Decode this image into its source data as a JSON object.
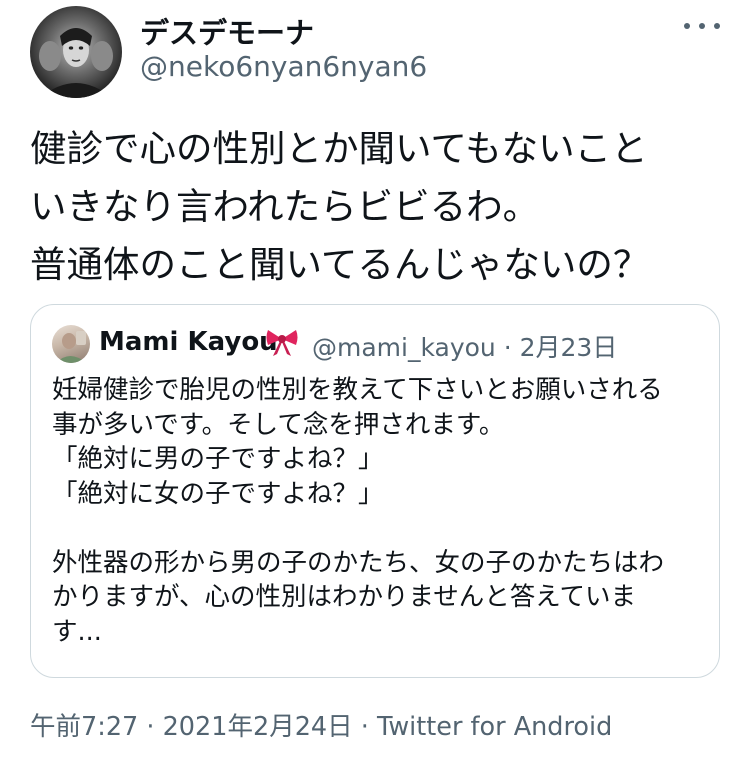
{
  "author": {
    "display_name": "デスデモーナ",
    "handle": "@neko6nyan6nyan6"
  },
  "tweet": {
    "lines": [
      "健診で心の性別とか聞いてもないこと",
      "いきなり言われたらビビるわ。",
      "普通体のこと聞いてるんじゃないの？"
    ]
  },
  "quoted_tweet": {
    "author_name": "Mami Kayou",
    "author_emoji_icon": "ribbon-icon",
    "handle_and_date": "@mami_kayou · 2月23日",
    "lines": [
      "妊婦健診で胎児の性別を教えて下さいとお願いされる",
      "事が多いです。そして念を押されます。",
      "「絶対に男の子ですよね？」",
      "「絶対に女の子ですよね？」",
      "",
      "外性器の形から男の子のかたち、女の子のかたちはわ",
      "かりますが、心の性別はわかりませんと答えていま",
      "す..."
    ]
  },
  "meta": {
    "timestamp_and_source": "午前7:27 · 2021年2月24日 · Twitter for Android"
  },
  "colors": {
    "text_primary": "#0f1419",
    "text_secondary": "#536471",
    "border": "#cfd9de",
    "ribbon": "#e0245e"
  }
}
